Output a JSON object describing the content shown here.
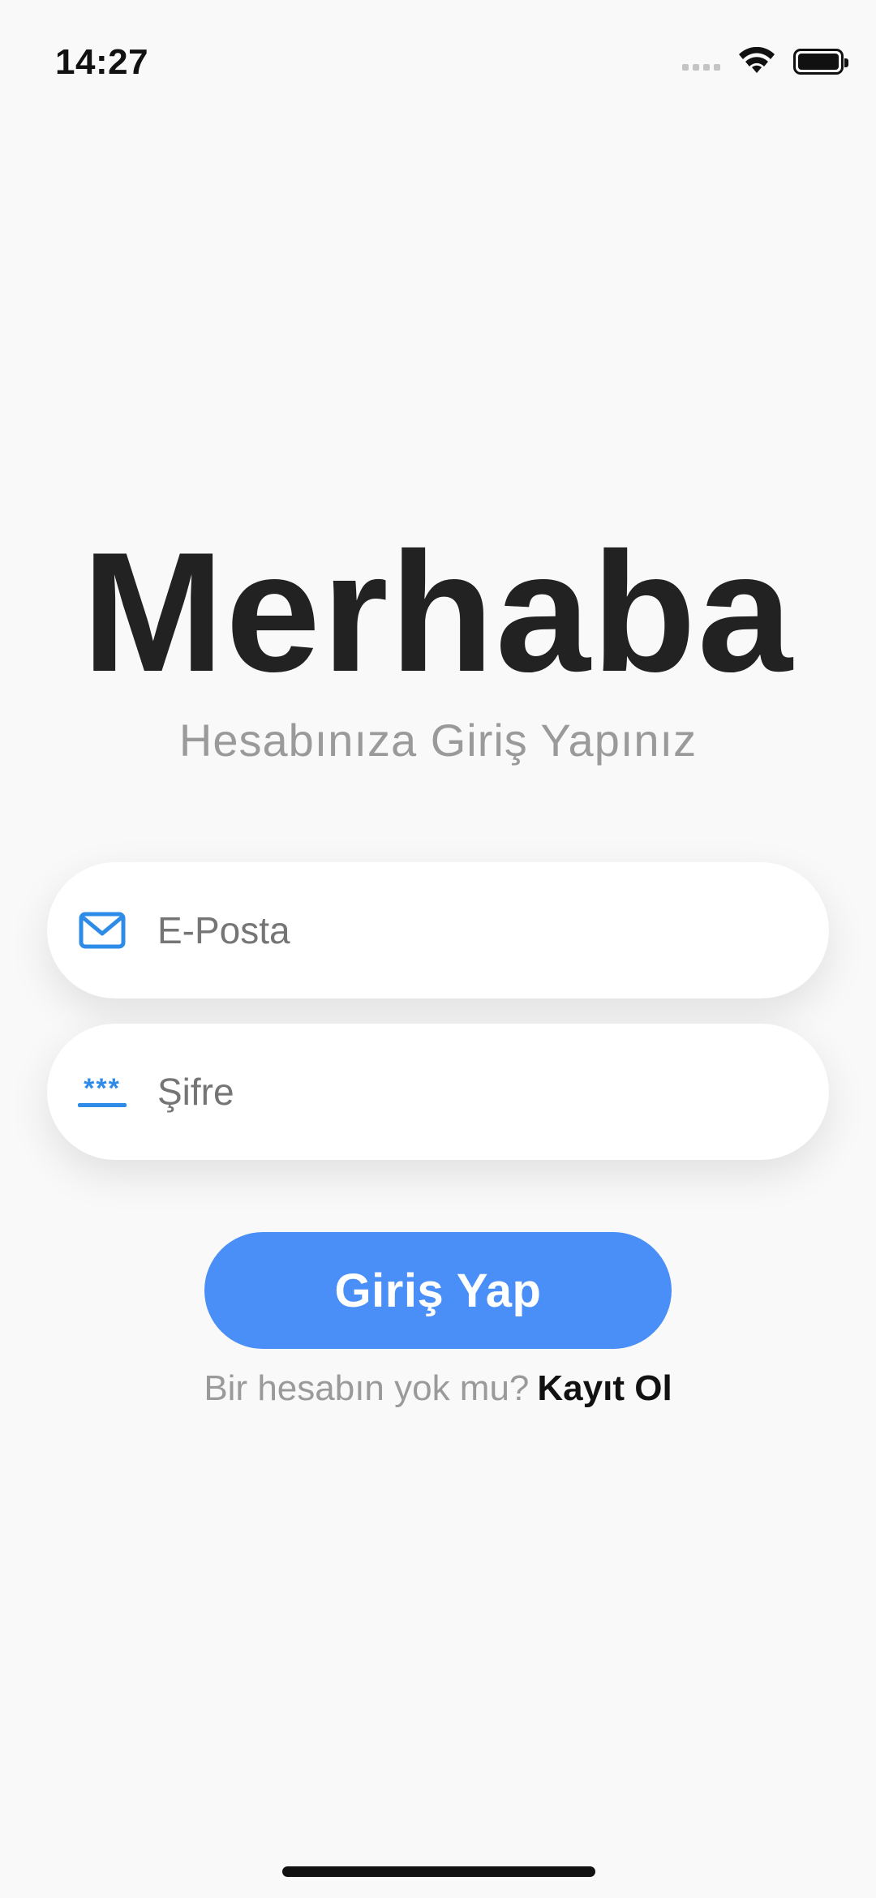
{
  "status_bar": {
    "time": "14:27",
    "icons": [
      "signal-icon",
      "wifi-icon",
      "battery-icon"
    ]
  },
  "header": {
    "title": "Merhaba",
    "subtitle": "Hesabınıza Giriş Yapınız"
  },
  "form": {
    "email": {
      "placeholder": "E-Posta",
      "value": "",
      "icon": "mail-icon"
    },
    "password": {
      "placeholder": "Şifre",
      "value": "",
      "icon": "password-icon"
    }
  },
  "login_button": {
    "label": "Giriş Yap"
  },
  "signup": {
    "prompt": "Bir hesabın yok mu?",
    "link_label": "Kayıt Ol"
  },
  "colors": {
    "accent": "#4a8ff7",
    "icon": "#2f8be8",
    "background": "#f9f9f9",
    "title": "#222222",
    "muted": "#9a9a9a"
  }
}
